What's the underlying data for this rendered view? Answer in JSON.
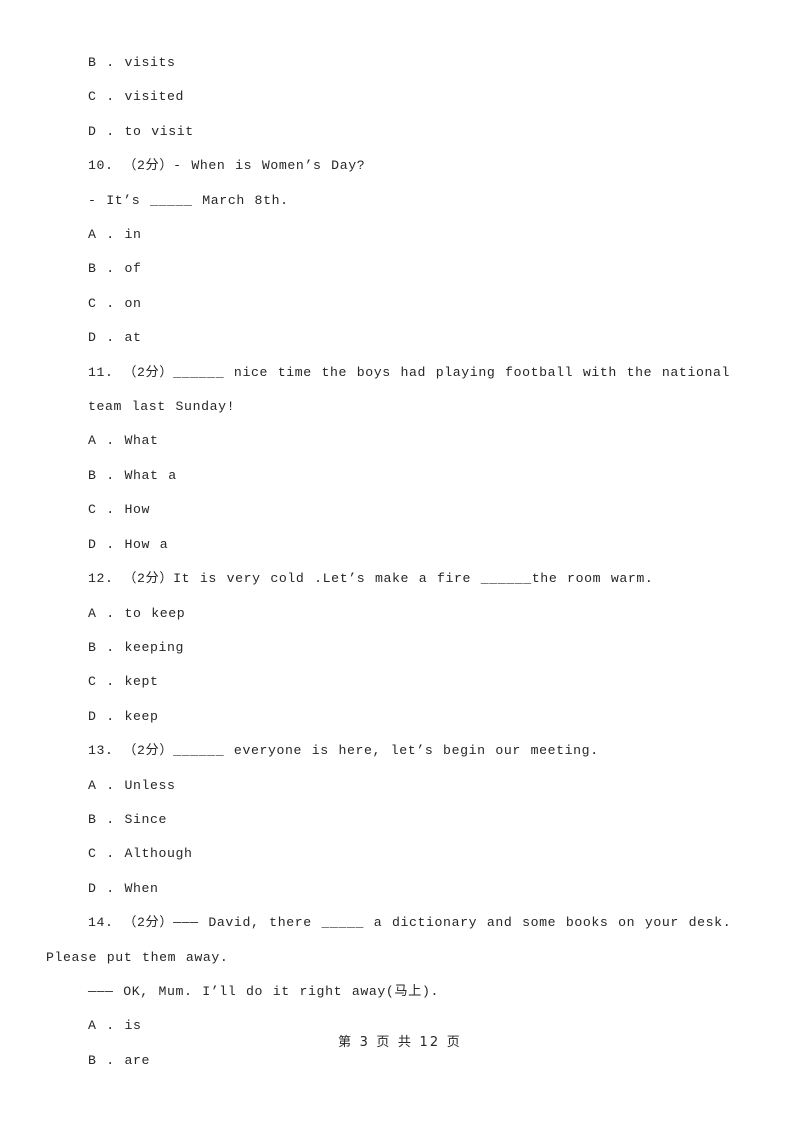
{
  "document": {
    "type": "exam-paper",
    "page_footer": {
      "prefix": "第",
      "page_number": "3",
      "middle": "页 共",
      "total_pages": "12",
      "suffix": "页",
      "full_text": "第 3 页 共 12 页"
    },
    "background_color": "#ffffff",
    "text_color": "#262626"
  },
  "lines": [
    {
      "id": "l1",
      "kind": "option",
      "text": "B . visits"
    },
    {
      "id": "l2",
      "kind": "option",
      "text": "C . visited"
    },
    {
      "id": "l3",
      "kind": "option",
      "text": "D . to visit"
    },
    {
      "id": "l4",
      "kind": "question",
      "number": "10.",
      "marks": "（2分）",
      "text": "10.  （2分）- When is Women’s Day?"
    },
    {
      "id": "l5",
      "kind": "subline",
      "text": "- It’s _____ March 8th."
    },
    {
      "id": "l6",
      "kind": "option",
      "text": "A . in"
    },
    {
      "id": "l7",
      "kind": "option",
      "text": "B . of"
    },
    {
      "id": "l8",
      "kind": "option",
      "text": "C . on"
    },
    {
      "id": "l9",
      "kind": "option",
      "text": "D . at"
    },
    {
      "id": "l10",
      "kind": "question",
      "number": "11.",
      "marks": "（2分）",
      "text": "11.  （2分）______ nice time the boys had playing football with the national team last Sunday!"
    },
    {
      "id": "l11",
      "kind": "option",
      "text": "A . What"
    },
    {
      "id": "l12",
      "kind": "option",
      "text": "B . What a"
    },
    {
      "id": "l13",
      "kind": "option",
      "text": "C . How"
    },
    {
      "id": "l14",
      "kind": "option",
      "text": "D . How a"
    },
    {
      "id": "l15",
      "kind": "question",
      "number": "12.",
      "marks": "（2分）",
      "text": "12.  （2分）It is very cold .Let’s make a fire ______the room warm."
    },
    {
      "id": "l16",
      "kind": "option",
      "text": "A . to keep"
    },
    {
      "id": "l17",
      "kind": "option",
      "text": "B . keeping"
    },
    {
      "id": "l18",
      "kind": "option",
      "text": "C . kept"
    },
    {
      "id": "l19",
      "kind": "option",
      "text": "D . keep"
    },
    {
      "id": "l20",
      "kind": "question",
      "number": "13.",
      "marks": "（2分）",
      "text": "13.  （2分）______ everyone is here, let’s begin our meeting."
    },
    {
      "id": "l21",
      "kind": "option",
      "text": "A . Unless"
    },
    {
      "id": "l22",
      "kind": "option",
      "text": "B . Since"
    },
    {
      "id": "l23",
      "kind": "option",
      "text": "C . Although"
    },
    {
      "id": "l24",
      "kind": "option",
      "text": "D . When"
    },
    {
      "id": "l25",
      "kind": "question-wrap",
      "number": "14.",
      "marks": "（2分）",
      "text": "14.  （2分）——— David, there _____ a dictionary and some books on your desk. Please put them away."
    },
    {
      "id": "l26",
      "kind": "subline",
      "text": "——— OK, Mum. I’ll do it right away(马上)."
    },
    {
      "id": "l27",
      "kind": "option",
      "text": "A . is"
    },
    {
      "id": "l28",
      "kind": "option",
      "text": "B . are"
    }
  ]
}
